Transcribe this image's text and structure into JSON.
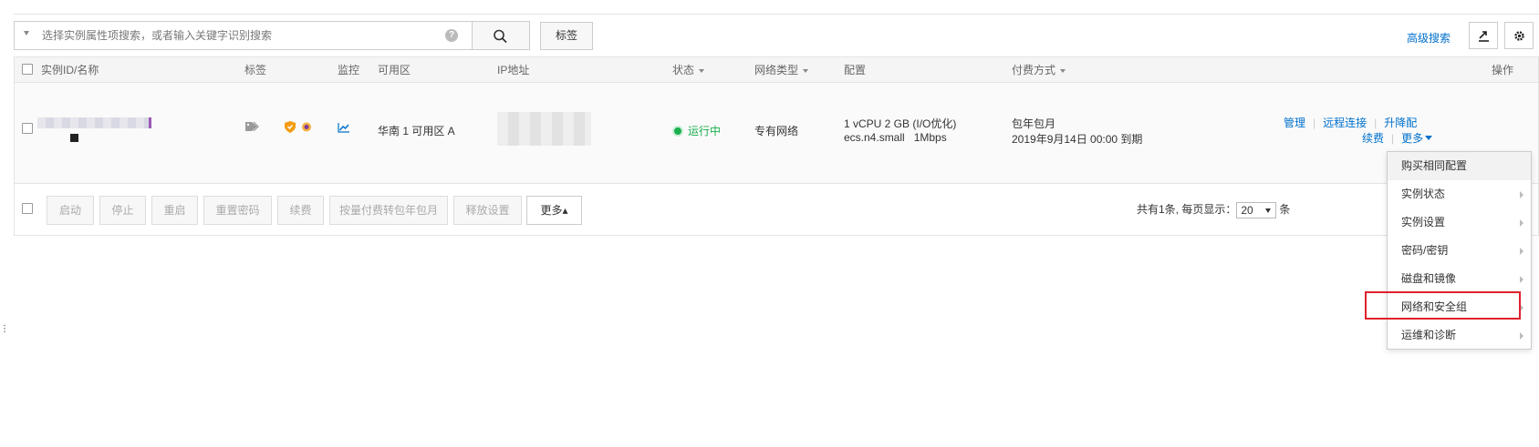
{
  "search": {
    "placeholder": "选择实例属性项搜索，或者输入关键字识别搜索",
    "help_glyph": "?",
    "tag_button_label": "标签",
    "advanced_search_label": "高级搜索"
  },
  "table": {
    "columns": [
      "实例ID/名称",
      "标签",
      "监控",
      "可用区",
      "IP地址",
      "状态",
      "网络类型",
      "配置",
      "付费方式",
      "操作"
    ],
    "row": {
      "zone": "华南 1 可用区 A",
      "status": "运行中",
      "network_type": "专有网络",
      "config_line1": "1 vCPU 2 GB (I/O优化)",
      "config_line2": "ecs.n4.small   1Mbps",
      "billing_line1": "包年包月",
      "billing_line2": "2019年9月14日 00:00 到期",
      "actions": {
        "manage": "管理",
        "remote": "远程连接",
        "upgrade": "升降配",
        "renew": "续费",
        "more": "更多"
      }
    }
  },
  "footer": {
    "buttons": [
      "启动",
      "停止",
      "重启",
      "重置密码",
      "续费",
      "按量付费转包年包月",
      "释放设置"
    ],
    "more_label": "更多▴",
    "pager_prefix": "共有1条, 每页显示：",
    "page_size": "20",
    "pager_suffix": "条"
  },
  "dropdown": {
    "items": [
      "购买相同配置",
      "实例状态",
      "实例设置",
      "密码/密钥",
      "磁盘和镜像",
      "网络和安全组",
      "运维和诊断"
    ]
  },
  "colors": {
    "link": "#0070cc",
    "status_running": "#1aaf4e",
    "highlight": "#e0202c"
  }
}
